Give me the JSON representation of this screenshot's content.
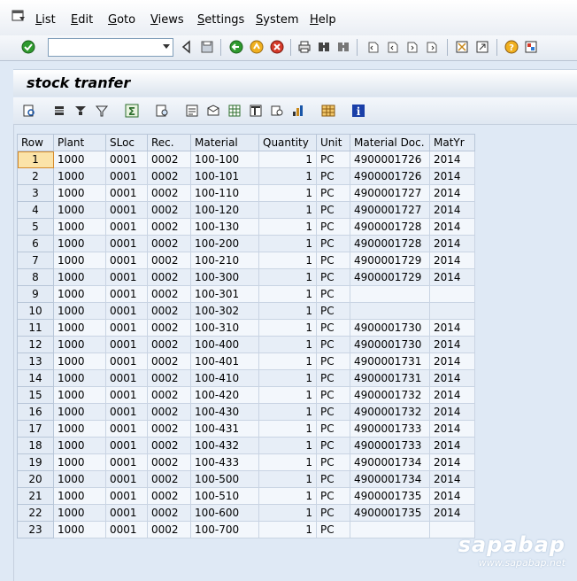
{
  "menu": {
    "items": [
      {
        "label": "List"
      },
      {
        "label": "Edit"
      },
      {
        "label": "Goto"
      },
      {
        "label": "Views"
      },
      {
        "label": "Settings"
      },
      {
        "label": "System"
      },
      {
        "label": "Help"
      }
    ]
  },
  "toolbar": {
    "command_field_value": ""
  },
  "screen": {
    "title": "stock tranfer"
  },
  "grid": {
    "columns": [
      "Row",
      "Plant",
      "SLoc",
      "Rec.",
      "Material",
      "Quantity",
      "Unit",
      "Material Doc.",
      "MatYr"
    ],
    "rows": [
      [
        "1",
        "1000",
        "0001",
        "0002",
        "100-100",
        "1",
        "PC",
        "4900001726",
        "2014"
      ],
      [
        "2",
        "1000",
        "0001",
        "0002",
        "100-101",
        "1",
        "PC",
        "4900001726",
        "2014"
      ],
      [
        "3",
        "1000",
        "0001",
        "0002",
        "100-110",
        "1",
        "PC",
        "4900001727",
        "2014"
      ],
      [
        "4",
        "1000",
        "0001",
        "0002",
        "100-120",
        "1",
        "PC",
        "4900001727",
        "2014"
      ],
      [
        "5",
        "1000",
        "0001",
        "0002",
        "100-130",
        "1",
        "PC",
        "4900001728",
        "2014"
      ],
      [
        "6",
        "1000",
        "0001",
        "0002",
        "100-200",
        "1",
        "PC",
        "4900001728",
        "2014"
      ],
      [
        "7",
        "1000",
        "0001",
        "0002",
        "100-210",
        "1",
        "PC",
        "4900001729",
        "2014"
      ],
      [
        "8",
        "1000",
        "0001",
        "0002",
        "100-300",
        "1",
        "PC",
        "4900001729",
        "2014"
      ],
      [
        "9",
        "1000",
        "0001",
        "0002",
        "100-301",
        "1",
        "PC",
        "",
        ""
      ],
      [
        "10",
        "1000",
        "0001",
        "0002",
        "100-302",
        "1",
        "PC",
        "",
        ""
      ],
      [
        "11",
        "1000",
        "0001",
        "0002",
        "100-310",
        "1",
        "PC",
        "4900001730",
        "2014"
      ],
      [
        "12",
        "1000",
        "0001",
        "0002",
        "100-400",
        "1",
        "PC",
        "4900001730",
        "2014"
      ],
      [
        "13",
        "1000",
        "0001",
        "0002",
        "100-401",
        "1",
        "PC",
        "4900001731",
        "2014"
      ],
      [
        "14",
        "1000",
        "0001",
        "0002",
        "100-410",
        "1",
        "PC",
        "4900001731",
        "2014"
      ],
      [
        "15",
        "1000",
        "0001",
        "0002",
        "100-420",
        "1",
        "PC",
        "4900001732",
        "2014"
      ],
      [
        "16",
        "1000",
        "0001",
        "0002",
        "100-430",
        "1",
        "PC",
        "4900001732",
        "2014"
      ],
      [
        "17",
        "1000",
        "0001",
        "0002",
        "100-431",
        "1",
        "PC",
        "4900001733",
        "2014"
      ],
      [
        "18",
        "1000",
        "0001",
        "0002",
        "100-432",
        "1",
        "PC",
        "4900001733",
        "2014"
      ],
      [
        "19",
        "1000",
        "0001",
        "0002",
        "100-433",
        "1",
        "PC",
        "4900001734",
        "2014"
      ],
      [
        "20",
        "1000",
        "0001",
        "0002",
        "100-500",
        "1",
        "PC",
        "4900001734",
        "2014"
      ],
      [
        "21",
        "1000",
        "0001",
        "0002",
        "100-510",
        "1",
        "PC",
        "4900001735",
        "2014"
      ],
      [
        "22",
        "1000",
        "0001",
        "0002",
        "100-600",
        "1",
        "PC",
        "4900001735",
        "2014"
      ],
      [
        "23",
        "1000",
        "0001",
        "0002",
        "100-700",
        "1",
        "PC",
        "",
        ""
      ]
    ],
    "selected_row": "1"
  },
  "watermark": {
    "brand": "sapabap",
    "url": "www.sapabap.net"
  },
  "icons": {
    "system_menu": "system-menu-icon",
    "enter": "enter-checkmark-icon",
    "back_nav": "triangle-left-icon",
    "save": "save-icon",
    "back": "back-icon",
    "exit": "exit-icon",
    "cancel": "cancel-icon",
    "print": "print-icon",
    "find": "find-icon",
    "find_next": "find-next-icon",
    "first_page": "first-page-icon",
    "prev_page": "previous-page-icon",
    "next_page": "next-page-icon",
    "last_page": "last-page-icon",
    "new_session": "new-session-icon",
    "shortcut": "create-shortcut-icon",
    "help": "help-icon",
    "layout": "customize-layout-icon"
  }
}
